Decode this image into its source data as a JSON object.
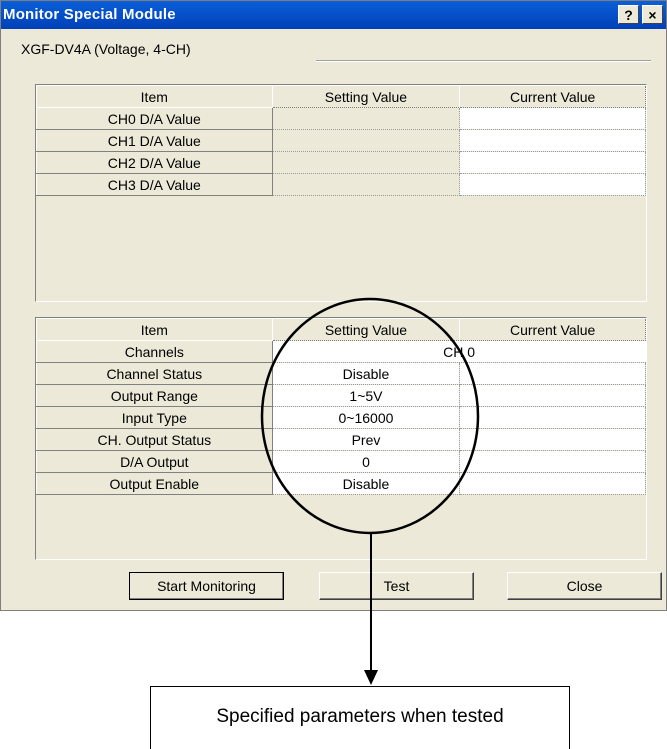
{
  "window": {
    "title": "Monitor Special Module",
    "help_button": "?",
    "close_button": "×"
  },
  "module": {
    "name": "XGF-DV4A (Voltage, 4-CH)"
  },
  "top_table": {
    "headers": [
      "Item",
      "Setting Value",
      "Current Value"
    ],
    "rows": [
      {
        "item": "CH0 D/A Value",
        "setting": "",
        "current": ""
      },
      {
        "item": "CH1 D/A Value",
        "setting": "",
        "current": ""
      },
      {
        "item": "CH2 D/A Value",
        "setting": "",
        "current": ""
      },
      {
        "item": "CH3 D/A Value",
        "setting": "",
        "current": ""
      }
    ]
  },
  "bottom_table": {
    "headers": [
      "Item",
      "Setting Value",
      "Current Value"
    ],
    "rows": [
      {
        "item": "Channels",
        "setting": "CH 0",
        "current": ""
      },
      {
        "item": "Channel Status",
        "setting": "Disable",
        "current": ""
      },
      {
        "item": "Output Range",
        "setting": "1~5V",
        "current": ""
      },
      {
        "item": "Input Type",
        "setting": "0~16000",
        "current": ""
      },
      {
        "item": "CH. Output Status",
        "setting": "Prev",
        "current": ""
      },
      {
        "item": "D/A Output",
        "setting": "0",
        "current": ""
      },
      {
        "item": "Output Enable",
        "setting": "Disable",
        "current": ""
      }
    ]
  },
  "buttons": {
    "start_monitoring": "Start Monitoring",
    "test": "Test",
    "close": "Close"
  },
  "callout": {
    "text": "Specified parameters when tested"
  }
}
